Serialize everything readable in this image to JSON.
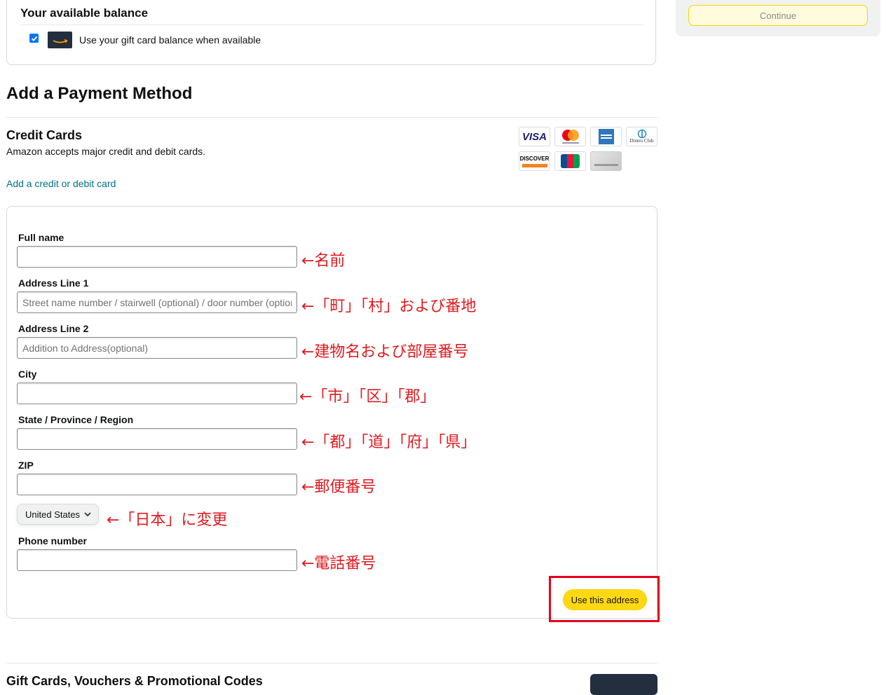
{
  "balance": {
    "title": "Your available balance",
    "gift_card_label": "Use your gift card balance when available",
    "gift_card_checked": true
  },
  "side": {
    "continue_label": "Continue"
  },
  "payment": {
    "section_title": "Add a Payment Method",
    "credit_cards_title": "Credit Cards",
    "credit_cards_desc": "Amazon accepts major credit and debit cards.",
    "add_card_link": "Add a credit or debit card",
    "card_logos": [
      "visa",
      "mastercard",
      "amex",
      "diners-club",
      "discover",
      "jcb",
      "amazon-store-card"
    ],
    "card_logo_text": {
      "visa": "VISA",
      "diners": "Diners Club",
      "discover": "DISCOVER",
      "jcb": "JCB"
    }
  },
  "form": {
    "full_name": {
      "label": "Full name",
      "value": "",
      "placeholder": "",
      "annotation": "←名前"
    },
    "address1": {
      "label": "Address Line 1",
      "value": "",
      "placeholder": "Street name number / stairwell (optional) / door number (optional)",
      "annotation": "←「町」「村」および番地"
    },
    "address2": {
      "label": "Address Line 2",
      "value": "",
      "placeholder": "Addition to Address(optional)",
      "annotation": "←建物名および部屋番号"
    },
    "city": {
      "label": "City",
      "value": "",
      "placeholder": "",
      "annotation": "←「市」「区」「郡」"
    },
    "state": {
      "label": "State / Province / Region",
      "value": "",
      "placeholder": "",
      "annotation": "←「都」「道」「府」「県」"
    },
    "zip": {
      "label": "ZIP",
      "value": "",
      "placeholder": "",
      "annotation": "←郵便番号"
    },
    "country": {
      "selected": "United States",
      "annotation": "←「日本」に変更"
    },
    "phone": {
      "label": "Phone number",
      "value": "",
      "placeholder": "",
      "annotation": "←電話番号"
    },
    "submit_label": "Use this address"
  },
  "gift": {
    "title": "Gift Cards, Vouchers & Promotional Codes"
  },
  "colors": {
    "highlight_box": "#e3001b",
    "annotation_text": "#e0191e",
    "primary_button": "#ffd814",
    "link": "#007185"
  }
}
